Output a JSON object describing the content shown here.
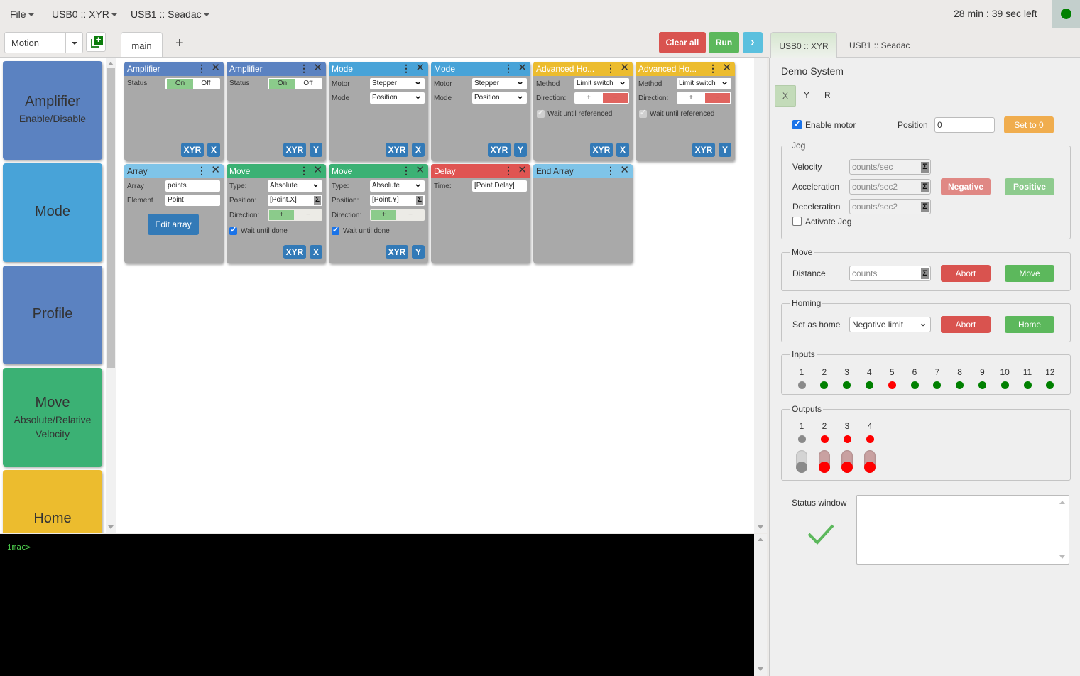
{
  "menu": {
    "file": "File",
    "device1": "USB0 :: XYR",
    "device2": "USB1 :: Seadac",
    "timer": "28 min : 39 sec left",
    "connection_status_color": "#008000"
  },
  "toolbar": {
    "category": "Motion",
    "tabs": [
      {
        "label": "main",
        "active": true
      }
    ],
    "add_tab": "+",
    "clear_all": "Clear all",
    "run": "Run",
    "next": "›"
  },
  "palette": {
    "items": [
      {
        "title": "Amplifier",
        "subtitle": "Enable/Disable",
        "color": "#5b82c1"
      },
      {
        "title": "Mode",
        "subtitle": "",
        "color": "#48a3d8"
      },
      {
        "title": "Profile",
        "subtitle": "",
        "color": "#5b82c1"
      },
      {
        "title": "Move",
        "subtitle": "Absolute/Relative",
        "subtitle2": "Velocity",
        "color": "#3bb174"
      },
      {
        "title": "Home",
        "subtitle": "",
        "color": "#ecbc2e"
      }
    ]
  },
  "blocks": {
    "amp1": {
      "title": "Amplifier",
      "status_label": "Status",
      "on": "On",
      "off": "Off",
      "state": "On",
      "group": "XYR",
      "axis": "X"
    },
    "amp2": {
      "title": "Amplifier",
      "status_label": "Status",
      "on": "On",
      "off": "Off",
      "state": "On",
      "group": "XYR",
      "axis": "Y"
    },
    "mode1": {
      "title": "Mode",
      "motor_label": "Motor",
      "motor": "Stepper",
      "mode_label": "Mode",
      "mode": "Position",
      "group": "XYR",
      "axis": "X"
    },
    "mode2": {
      "title": "Mode",
      "motor_label": "Motor",
      "motor": "Stepper",
      "mode_label": "Mode",
      "mode": "Position",
      "group": "XYR",
      "axis": "Y"
    },
    "home1": {
      "title": "Advanced Ho...",
      "method_label": "Method",
      "method": "Limit switch",
      "direction_label": "Direction:",
      "plus": "+",
      "minus": "−",
      "direction": "−",
      "wait_label": "Wait until referenced",
      "wait": true,
      "group": "XYR",
      "axis": "X"
    },
    "home2": {
      "title": "Advanced Ho...",
      "method_label": "Method",
      "method": "Limit switch",
      "direction_label": "Direction:",
      "plus": "+",
      "minus": "−",
      "direction": "−",
      "wait_label": "Wait until referenced",
      "wait": true,
      "group": "XYR",
      "axis": "Y"
    },
    "array": {
      "title": "Array",
      "array_label": "Array",
      "array": "points",
      "element_label": "Element",
      "element": "Point",
      "edit": "Edit array"
    },
    "move1": {
      "title": "Move",
      "type_label": "Type:",
      "type": "Absolute",
      "position_label": "Position:",
      "position": "[Point.X]",
      "direction_label": "Direction:",
      "plus": "+",
      "minus": "−",
      "direction": "+",
      "wait_label": "Wait until done",
      "wait": true,
      "group": "XYR",
      "axis": "X"
    },
    "move2": {
      "title": "Move",
      "type_label": "Type:",
      "type": "Absolute",
      "position_label": "Position:",
      "position": "[Point.Y]",
      "direction_label": "Direction:",
      "plus": "+",
      "minus": "−",
      "direction": "+",
      "wait_label": "Wait until done",
      "wait": true,
      "group": "XYR",
      "axis": "Y"
    },
    "delay": {
      "title": "Delay",
      "time_label": "Time:",
      "time": "[Point.Delay]"
    },
    "endarray": {
      "title": "End Array"
    }
  },
  "block_colors": {
    "amplifier": "#5b82c1",
    "mode": "#48a3d8",
    "home": "#ecbc2e",
    "array": "#7fc4e8",
    "move": "#3bb174",
    "delay": "#e05452"
  },
  "terminal": {
    "prompt": "imac>"
  },
  "right_panel": {
    "tabs": [
      "USB0 :: XYR",
      "USB1 :: Seadac"
    ],
    "system_name": "Demo System",
    "axes": [
      "X",
      "Y",
      "R"
    ],
    "selected_axis": "X",
    "enable_motor_label": "Enable motor",
    "enable_motor": true,
    "position_label": "Position",
    "position_value": "0",
    "set_zero": "Set to 0",
    "jog": {
      "legend": "Jog",
      "velocity_label": "Velocity",
      "velocity_placeholder": "counts/sec",
      "acceleration_label": "Acceleration",
      "acceleration_placeholder": "counts/sec2",
      "deceleration_label": "Deceleration",
      "deceleration_placeholder": "counts/sec2",
      "negative": "Negative",
      "positive": "Positive",
      "activate_label": "Activate Jog",
      "activate": false
    },
    "move": {
      "legend": "Move",
      "distance_label": "Distance",
      "distance_placeholder": "counts",
      "abort": "Abort",
      "move": "Move"
    },
    "homing": {
      "legend": "Homing",
      "set_home_label": "Set as home",
      "set_home_value": "Negative limit",
      "abort": "Abort",
      "home": "Home"
    },
    "inputs": {
      "legend": "Inputs",
      "items": [
        {
          "n": "1",
          "state": "off"
        },
        {
          "n": "2",
          "state": "on"
        },
        {
          "n": "3",
          "state": "on"
        },
        {
          "n": "4",
          "state": "on"
        },
        {
          "n": "5",
          "state": "fault"
        },
        {
          "n": "6",
          "state": "on"
        },
        {
          "n": "7",
          "state": "on"
        },
        {
          "n": "8",
          "state": "on"
        },
        {
          "n": "9",
          "state": "on"
        },
        {
          "n": "10",
          "state": "on"
        },
        {
          "n": "11",
          "state": "on"
        },
        {
          "n": "12",
          "state": "on"
        }
      ]
    },
    "outputs": {
      "legend": "Outputs",
      "items": [
        {
          "n": "1",
          "state": "off"
        },
        {
          "n": "2",
          "state": "active"
        },
        {
          "n": "3",
          "state": "active"
        },
        {
          "n": "4",
          "state": "active"
        }
      ]
    },
    "status_window_label": "Status window",
    "status_window_text": ""
  },
  "led_colors": {
    "off": "#8a8a8a",
    "on": "#008000",
    "fault": "#ff0000",
    "active": "#ff0000"
  }
}
